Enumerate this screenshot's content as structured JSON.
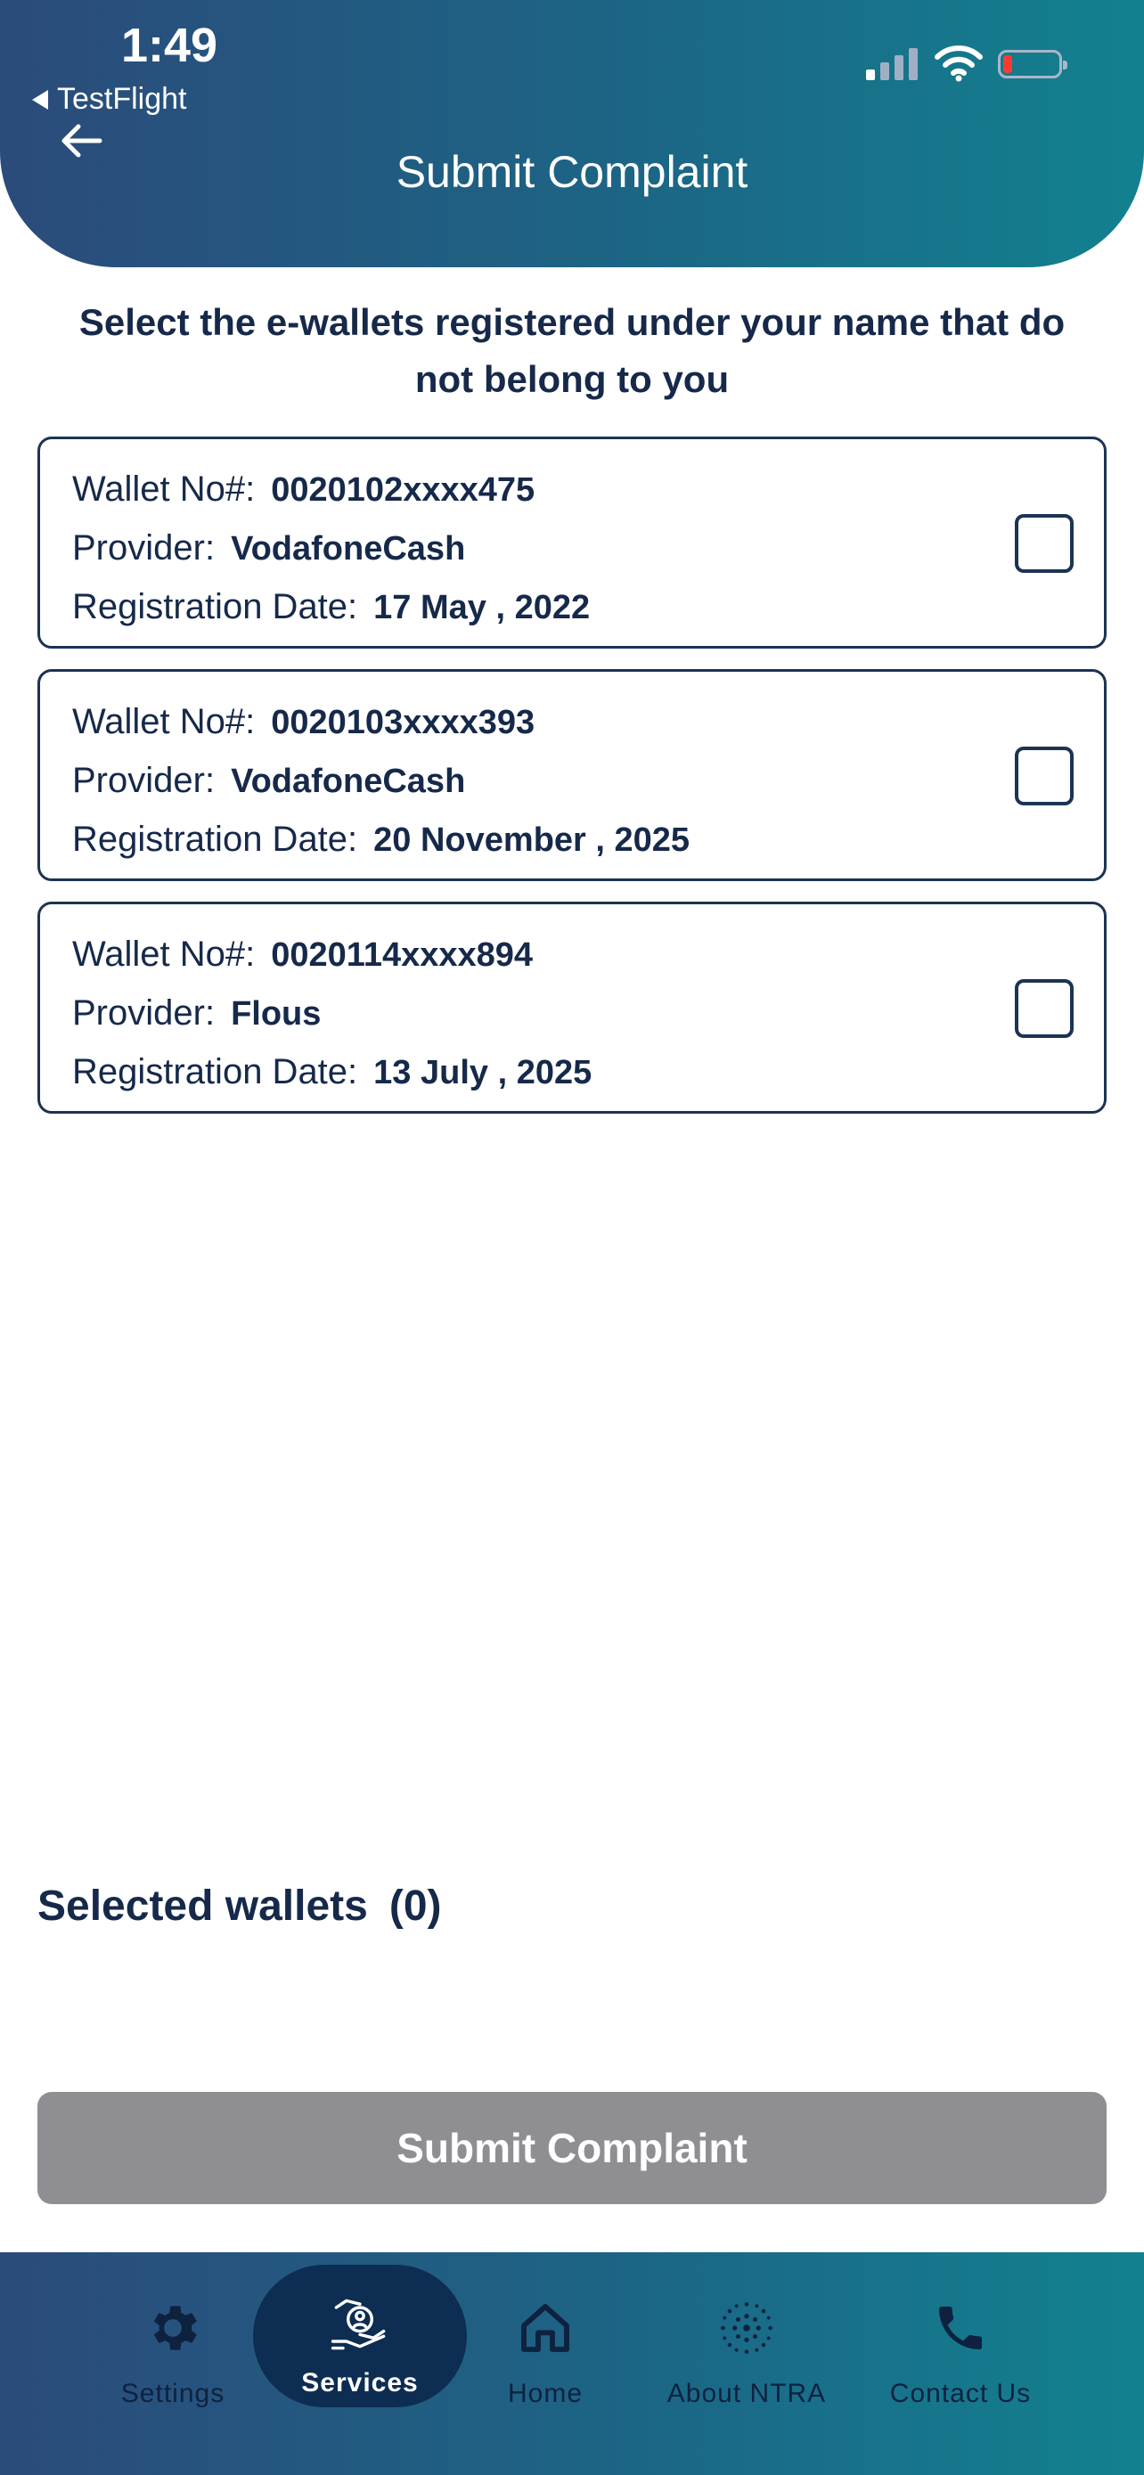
{
  "status_bar": {
    "time": "1:49",
    "back_app": "TestFlight"
  },
  "header": {
    "title": "Submit Complaint"
  },
  "instruction": "Select the e-wallets registered under your name that do not belong to you",
  "labels": {
    "wallet_no": "Wallet No#:",
    "provider": "Provider:",
    "registration_date": "Registration Date:"
  },
  "wallets": [
    {
      "wallet_no": "0020102xxxx475",
      "provider": "VodafoneCash",
      "registration_date": "17 May , 2022",
      "checked": false
    },
    {
      "wallet_no": "0020103xxxx393",
      "provider": "VodafoneCash",
      "registration_date": "20 November , 2025",
      "checked": false
    },
    {
      "wallet_no": "0020114xxxx894",
      "provider": "Flous",
      "registration_date": "13 July , 2025",
      "checked": false
    }
  ],
  "selected": {
    "label": "Selected wallets",
    "count": "(0)"
  },
  "submit_button": {
    "label": "Submit Complaint",
    "color": "#8e8e93"
  },
  "tabs": [
    {
      "label": "Settings",
      "icon": "gear-icon"
    },
    {
      "label": "Services",
      "icon": "services-icon",
      "active": true
    },
    {
      "label": "Home",
      "icon": "home-icon"
    },
    {
      "label": "About NTRA",
      "icon": "ntra-logo-icon"
    },
    {
      "label": "Contact Us",
      "icon": "phone-icon"
    }
  ],
  "colors": {
    "header_start": "#2b4b7a",
    "header_end": "#12818f",
    "text": "#16294a"
  }
}
